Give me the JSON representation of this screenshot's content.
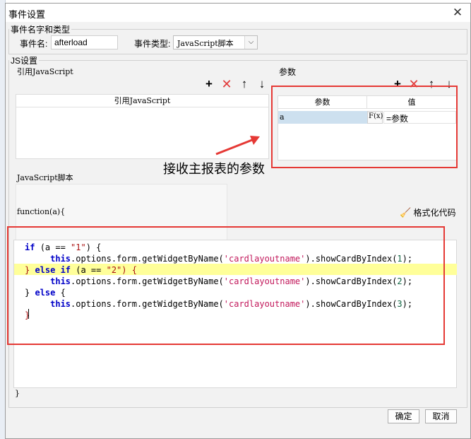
{
  "window": {
    "title": "事件设置"
  },
  "event_group": {
    "legend": "事件名字和类型",
    "name_label": "事件名:",
    "name_value": "afterload",
    "type_label": "事件类型:",
    "type_value": "JavaScript脚本"
  },
  "js_group": {
    "legend": "JS设置",
    "ref_label": "引用JavaScript",
    "params_label": "参数",
    "ref_column_header": "引用JavaScript",
    "param_col_header": "参数",
    "value_col_header": "值",
    "param_rows": [
      {
        "name": "a",
        "formula_icon": "F(x)",
        "value": "=参数"
      }
    ],
    "script_label": "JavaScript脚本",
    "function_header": "function(a){",
    "format_label": "格式化代码",
    "closing_brace": "}"
  },
  "annotation": {
    "text": "接收主报表的参数"
  },
  "code_lines": [
    [
      [
        "if ",
        "kw"
      ],
      [
        "(a == ",
        ""
      ],
      [
        "\"1\"",
        "str"
      ],
      [
        ") {",
        ""
      ]
    ],
    [
      [
        "     ",
        ""
      ],
      [
        "this",
        "kw"
      ],
      [
        ".options.form.getWidgetByName(",
        ""
      ],
      [
        "'cardlayoutname'",
        "strp"
      ],
      [
        ").showCardByIndex(",
        ""
      ],
      [
        "1",
        "num"
      ],
      [
        ");",
        ""
      ]
    ],
    [
      [
        "} ",
        "str"
      ],
      [
        "else if ",
        "kw"
      ],
      [
        "(a == ",
        ""
      ],
      [
        "\"2\"",
        "str"
      ],
      [
        ") {",
        "str"
      ]
    ],
    [
      [
        "     ",
        ""
      ],
      [
        "this",
        "kw"
      ],
      [
        ".options.form.getWidgetByName(",
        ""
      ],
      [
        "'cardlayoutname'",
        "strp"
      ],
      [
        ").showCardByIndex(",
        ""
      ],
      [
        "2",
        "num"
      ],
      [
        ");",
        ""
      ]
    ],
    [
      [
        "} ",
        ""
      ],
      [
        "else",
        "kw"
      ],
      [
        " {",
        ""
      ]
    ],
    [
      [
        "     ",
        ""
      ],
      [
        "this",
        "kw"
      ],
      [
        ".options.form.getWidgetByName(",
        ""
      ],
      [
        "'cardlayoutname'",
        "strp"
      ],
      [
        ").showCardByIndex(",
        ""
      ],
      [
        "3",
        "num"
      ],
      [
        ");",
        ""
      ]
    ],
    [
      [
        "}",
        "str"
      ]
    ]
  ],
  "footer": {
    "ok_label": "确定",
    "cancel_label": "取消"
  },
  "icons": {
    "add": "+",
    "delete": "✕",
    "up": "↑",
    "down": "↓",
    "close": "✕",
    "broom": "🧹"
  },
  "colors": {
    "highlight_box": "#e53935",
    "code_highlight_line": "#ffff99",
    "row_selected": "#cde0ef"
  }
}
